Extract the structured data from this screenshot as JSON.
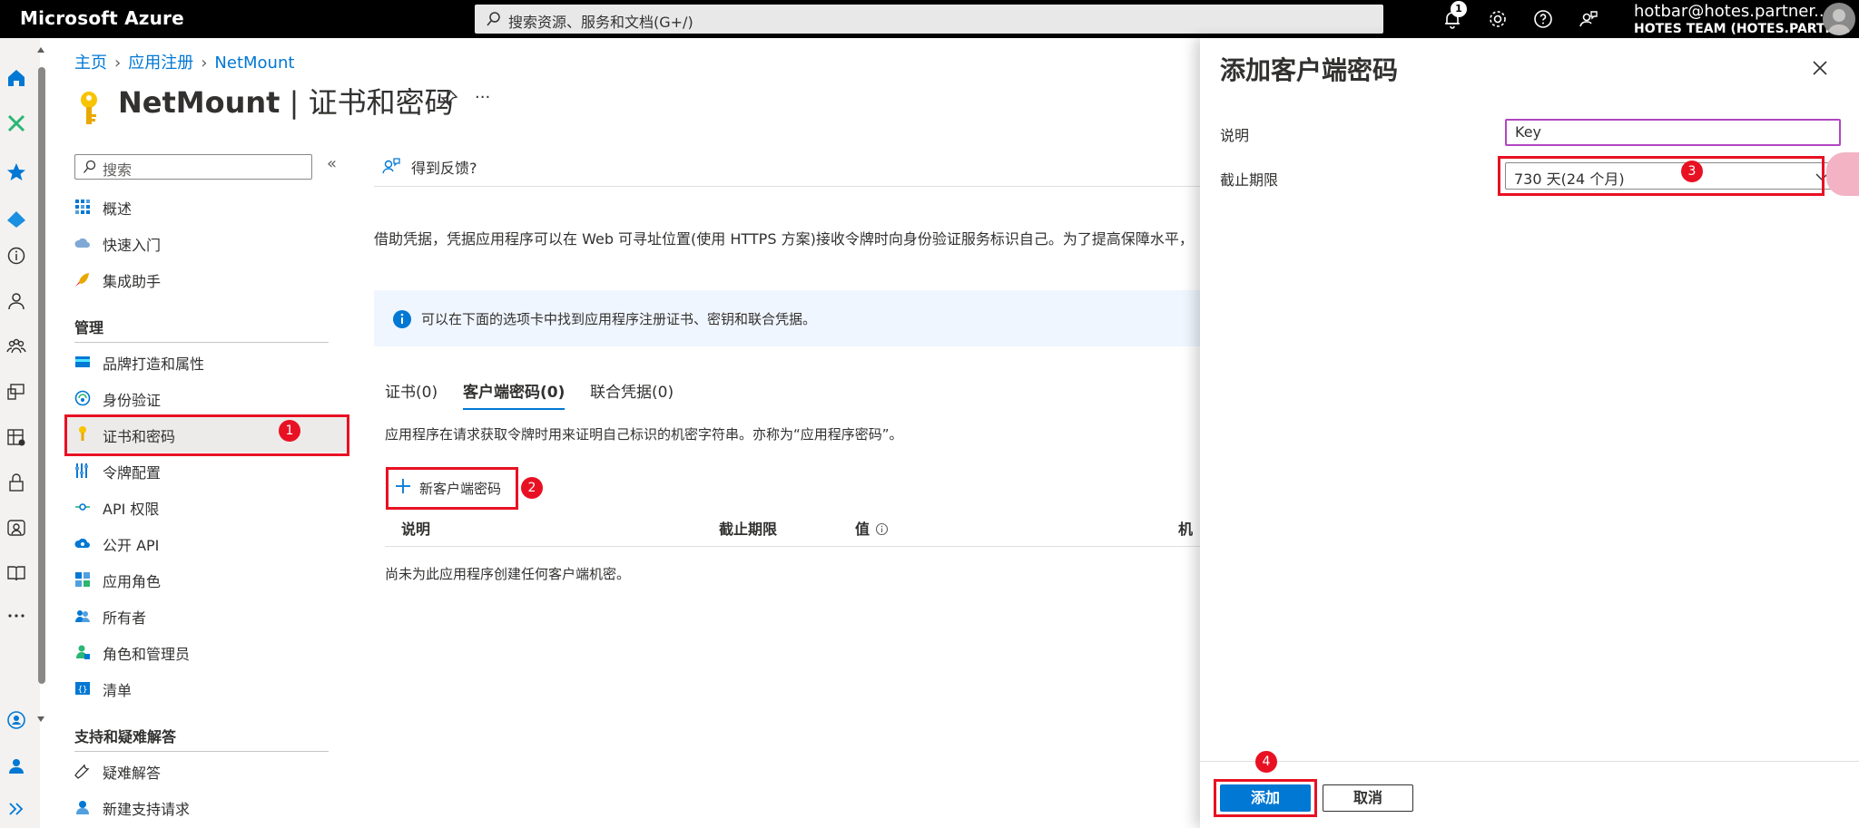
{
  "topbar": {
    "brand": "Microsoft Azure",
    "search_placeholder": "搜索资源、服务和文档(G+/)",
    "notification_count": "1",
    "account_name": "hotbar@hotes.partner...",
    "account_org": "HOTES TEAM (HOTES.PARTN..."
  },
  "breadcrumb": {
    "home": "主页",
    "app_reg": "应用注册",
    "app": "NetMount"
  },
  "title": {
    "app": "NetMount",
    "section": "| 证书和密码",
    "more": "···"
  },
  "menu": {
    "search_placeholder": "搜索",
    "collapse": "«",
    "top_items": [
      {
        "label": "概述",
        "icon": "overview-grid-icon"
      },
      {
        "label": "快速入门",
        "icon": "cloud-quickstart-icon"
      },
      {
        "label": "集成助手",
        "icon": "rocket-icon"
      }
    ],
    "manage_heading": "管理",
    "manage_items": [
      {
        "label": "品牌打造和属性",
        "icon": "branding-card-icon"
      },
      {
        "label": "身份验证",
        "icon": "authentication-icon"
      },
      {
        "label": "证书和密码",
        "icon": "key-icon"
      },
      {
        "label": "令牌配置",
        "icon": "token-bars-icon"
      },
      {
        "label": "API 权限",
        "icon": "api-permissions-icon"
      },
      {
        "label": "公开 API",
        "icon": "cloud-api-icon"
      },
      {
        "label": "应用角色",
        "icon": "app-roles-grid-icon"
      },
      {
        "label": "所有者",
        "icon": "owners-people-icon"
      },
      {
        "label": "角色和管理员",
        "icon": "roles-admins-icon"
      },
      {
        "label": "清单",
        "icon": "manifest-icon"
      }
    ],
    "support_heading": "支持和疑难解答",
    "support_items": [
      {
        "label": "疑难解答",
        "icon": "wrench-icon"
      },
      {
        "label": "新建支持请求",
        "icon": "support-person-icon"
      }
    ]
  },
  "content": {
    "feedback": "得到反馈?",
    "description": "借助凭据，凭据应用程序可以在 Web 可寻址位置(使用 HTTPS 方案)接收令牌时向身份验证服务标识自己。为了提高保障水平，",
    "info": "可以在下面的选项卡中找到应用程序注册证书、密钥和联合凭据。",
    "tabs": [
      "证书(0)",
      "客户端密码(0)",
      "联合凭据(0)"
    ],
    "tab_description": "应用程序在请求获取令牌时用来证明自己标识的机密字符串。亦称为“应用程序密码”。",
    "new_secret": "新客户端密码",
    "columns": [
      "说明",
      "截止期限",
      "值",
      "机"
    ],
    "empty": "尚未为此应用程序创建任何客户端机密。"
  },
  "blade": {
    "title": "添加客户端密码",
    "description_label": "说明",
    "description_value": "Key",
    "expires_label": "截止期限",
    "expires_value": "730 天(24 个月)",
    "add": "添加",
    "cancel": "取消"
  },
  "steps": [
    "1",
    "2",
    "3",
    "4"
  ],
  "colors": {
    "accent": "#0078d4",
    "highlight": "#e81123",
    "topbar": "#000000"
  }
}
